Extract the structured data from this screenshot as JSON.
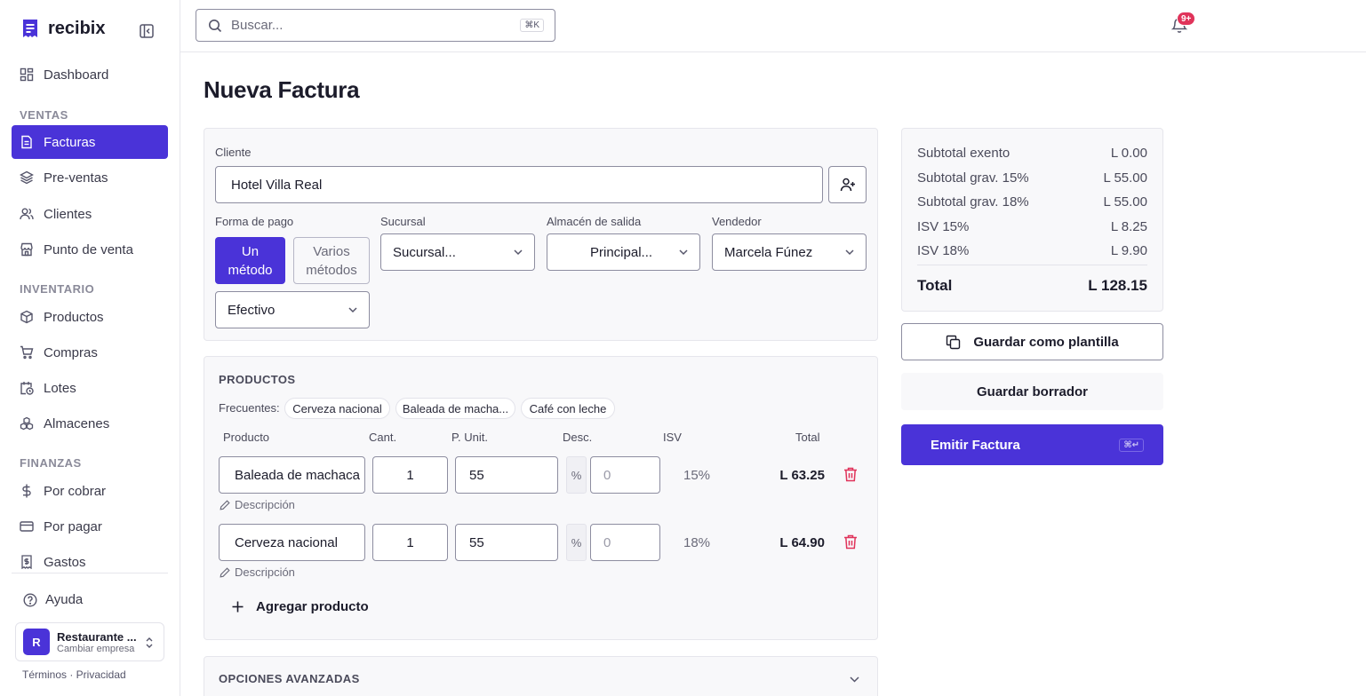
{
  "app": {
    "name": "recibix"
  },
  "sidebar": {
    "dashboard": "Dashboard",
    "sections": {
      "ventas": "VENTAS",
      "inventario": "INVENTARIO",
      "finanzas": "FINANZAS"
    },
    "ventas": [
      "Facturas",
      "Pre-ventas",
      "Clientes",
      "Punto de venta"
    ],
    "inventario": [
      "Productos",
      "Compras",
      "Lotes",
      "Almacenes"
    ],
    "finanzas": [
      "Por cobrar",
      "Por pagar",
      "Gastos"
    ],
    "active": "Facturas",
    "help": "Ayuda",
    "company": {
      "initial": "R",
      "name": "Restaurante ...",
      "sub": "Cambiar empresa"
    },
    "legal": "Términos · Privacidad"
  },
  "topbar": {
    "search_placeholder": "Buscar...",
    "shortcut": "⌘K",
    "notifications_badge": "9+"
  },
  "page": {
    "title": "Nueva Factura"
  },
  "form": {
    "cliente_label": "Cliente",
    "cliente_value": "Hotel Villa Real",
    "forma_pago_label": "Forma de pago",
    "un_metodo": "Un método",
    "varios_metodos": "Varios métodos",
    "metodo_value": "Efectivo",
    "sucursal_label": "Sucursal",
    "sucursal_value": "Sucursal...",
    "almacen_label": "Almacén de salida",
    "almacen_value": "Principal...",
    "vendedor_label": "Vendedor",
    "vendedor_value": "Marcela Fúnez"
  },
  "products": {
    "title": "PRODUCTOS",
    "frequent_label": "Frecuentes:",
    "frequent": [
      "Cerveza nacional",
      "Baleada de macha...",
      "Café con leche"
    ],
    "headers": {
      "producto": "Producto",
      "cant": "Cant.",
      "punit": "P. Unit.",
      "desc": "Desc.",
      "isv": "ISV",
      "total": "Total"
    },
    "percent_symbol": "%",
    "description_label": "Descripción",
    "rows": [
      {
        "product": "Baleada de machaca",
        "qty": "1",
        "price": "55",
        "discount_placeholder": "0",
        "isv": "15%",
        "total": "L 63.25"
      },
      {
        "product": "Cerveza nacional",
        "qty": "1",
        "price": "55",
        "discount_placeholder": "0",
        "isv": "18%",
        "total": "L 64.90"
      }
    ],
    "add_label": "Agregar producto"
  },
  "advanced": {
    "title": "OPCIONES AVANZADAS"
  },
  "summary": {
    "rows": [
      {
        "label": "Subtotal exento",
        "value": "L 0.00"
      },
      {
        "label": "Subtotal grav. 15%",
        "value": "L 55.00"
      },
      {
        "label": "Subtotal grav. 18%",
        "value": "L 55.00"
      },
      {
        "label": "ISV 15%",
        "value": "L 8.25"
      },
      {
        "label": "ISV 18%",
        "value": "L 9.90"
      }
    ],
    "total_label": "Total",
    "total_value": "L 128.15"
  },
  "actions": {
    "template": "Guardar como plantilla",
    "draft": "Guardar borrador",
    "emit": "Emitir Factura",
    "emit_shortcut": "⌘↵"
  },
  "colors": {
    "accent": "#4a33d8",
    "danger": "#e0335a"
  }
}
